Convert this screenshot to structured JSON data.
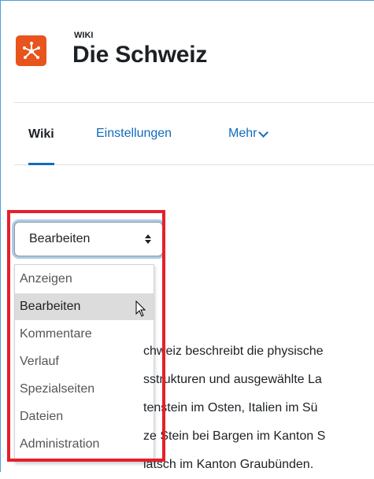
{
  "module": {
    "label": "WIKI",
    "icon": "wiki-network-icon",
    "accent": "#e8541d"
  },
  "page": {
    "title": "Die Schweiz"
  },
  "tabs": [
    {
      "label": "Wiki",
      "active": true
    },
    {
      "label": "Einstellungen"
    },
    {
      "label": "Mehr"
    }
  ],
  "select": {
    "value": "Bearbeiten",
    "options": [
      "Anzeigen",
      "Bearbeiten",
      "Kommentare",
      "Verlauf",
      "Spezialseiten",
      "Dateien",
      "Administration"
    ]
  },
  "content": {
    "lines": [
      "chweiz beschreibt die physische",
      "sstrukturen und ausgewählte La",
      "tenstein im Osten, Italien im Sü",
      "ze Stein bei Bargen im Kanton S",
      "latsch im Kanton Graubünden."
    ]
  },
  "colors": {
    "link": "#0f6cbf",
    "highlight": "#e6202b"
  }
}
